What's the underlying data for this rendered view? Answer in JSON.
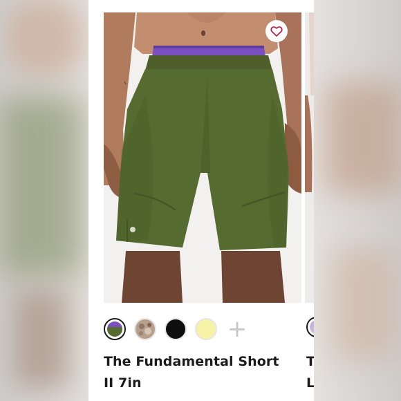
{
  "product": {
    "title": "The Fundamental Short II 7in",
    "favorite_icon": "heart-outline-icon",
    "waistband_color": "#7a4fc2",
    "main_color": "#556b2f"
  },
  "swatches": [
    {
      "name": "olive",
      "color": "#556b2f",
      "selected": true
    },
    {
      "name": "camo",
      "color": "#b79f8c",
      "selected": false
    },
    {
      "name": "black",
      "color": "#0e0e0e",
      "selected": false
    },
    {
      "name": "pale-yellow",
      "color": "#f6f3a6",
      "selected": false
    }
  ],
  "more_colors_label": "+",
  "next_card": {
    "title_fragment": "T\nL"
  }
}
